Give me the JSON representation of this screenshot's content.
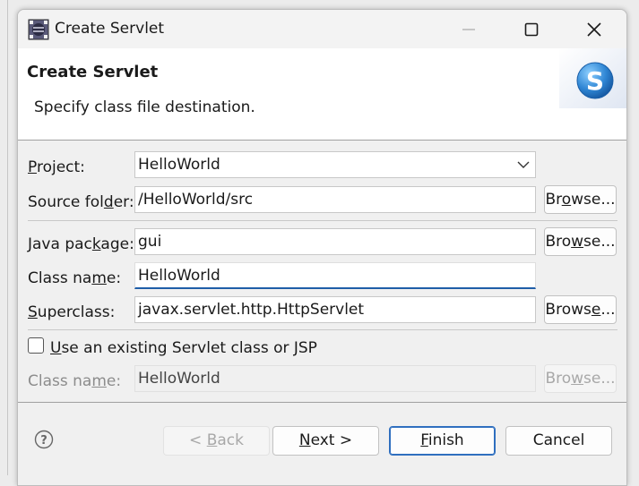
{
  "window": {
    "title": "Create Servlet",
    "controls": [
      "minimize-icon",
      "maximize-icon",
      "close-icon"
    ]
  },
  "banner": {
    "title": "Create Servlet",
    "message": "Specify class file destination.",
    "image": "servlet-wizard-icon",
    "accent": "#2f86d4"
  },
  "form": {
    "project": {
      "label_pre": "",
      "label_key": "P",
      "label_post": "roject:",
      "value": "HelloWorld"
    },
    "source_folder": {
      "label_pre": "Source fol",
      "label_key": "d",
      "label_post": "er:",
      "value": "/HelloWorld/src",
      "browse_pre": "Br",
      "browse_key": "o",
      "browse_post": "wse..."
    },
    "java_package": {
      "label_pre": "Java pac",
      "label_key": "k",
      "label_post": "age:",
      "value": "gui",
      "browse_pre": "Bro",
      "browse_key": "w",
      "browse_post": "se..."
    },
    "class_name": {
      "label_pre": "Class na",
      "label_key": "m",
      "label_post": "e:",
      "value": "HelloWorld"
    },
    "superclass": {
      "label_pre": "",
      "label_key": "S",
      "label_post": "uperclass:",
      "value": "javax.servlet.http.HttpServlet",
      "browse_pre": "Brows",
      "browse_key": "e",
      "browse_post": "..."
    },
    "use_existing": {
      "label_pre": "",
      "label_key": "U",
      "label_post": "se an existing Servlet class or JSP",
      "checked": false
    },
    "existing_class": {
      "label_pre": "Class na",
      "label_key": "m",
      "label_post": "e:",
      "value": "HelloWorld",
      "browse_pre": "Bro",
      "browse_key": "w",
      "browse_post": "se...",
      "enabled": false
    }
  },
  "footer": {
    "help_icon": "help-icon",
    "back": {
      "pre": "< ",
      "key": "B",
      "post": "ack",
      "enabled": false
    },
    "next": {
      "pre": "",
      "key": "N",
      "post": "ext >"
    },
    "finish": {
      "pre": "",
      "key": "F",
      "post": "inish"
    },
    "cancel": {
      "label": "Cancel"
    }
  }
}
